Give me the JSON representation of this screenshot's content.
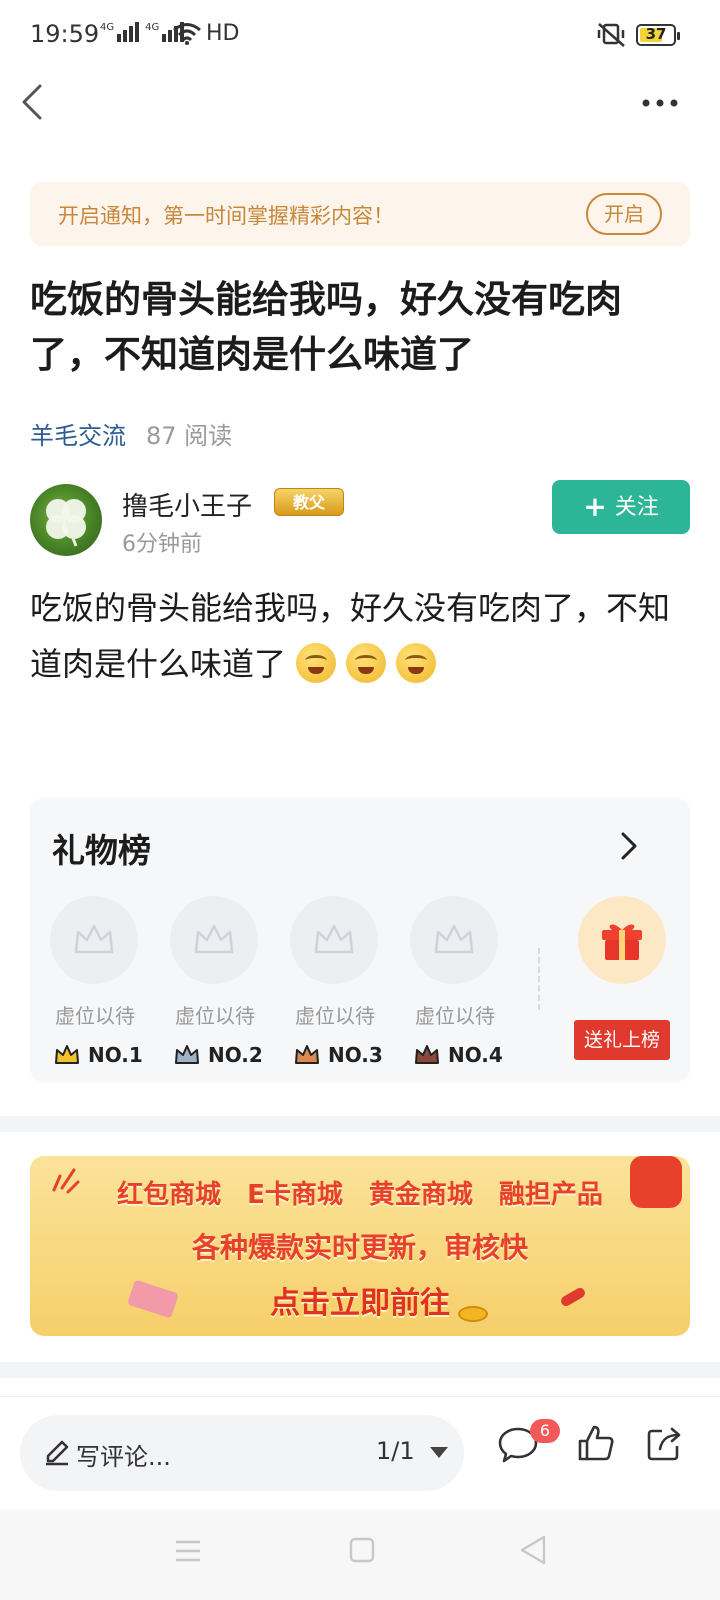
{
  "status_bar": {
    "time": "19:59",
    "network1": "4G",
    "network2": "4G",
    "hd_label": "HD",
    "battery": "37",
    "battery_color": "#f2d33a"
  },
  "nav": {
    "back_icon": "chevron-left-icon",
    "more_icon": "more-dots-icon"
  },
  "notify": {
    "text": "开启通知，第一时间掌握精彩内容！",
    "button_label": "开启",
    "color": "#c7883a"
  },
  "post": {
    "title": "吃饭的骨头能给我吗，好久没有吃肉了，不知道肉是什么味道了",
    "category": "羊毛交流",
    "read_count": "87 阅读",
    "body": "吃饭的骨头能给我吗，好久没有吃肉了，不知道肉是什么味道了",
    "emoji_count": 3
  },
  "author": {
    "name": "撸毛小王子",
    "badge": "教父",
    "time": "6分钟前",
    "follow_label": "关注",
    "follow_color": "#2cb596"
  },
  "gift_board": {
    "title": "礼物榜",
    "slots": [
      {
        "label": "虚位以待",
        "rank": "NO.1",
        "crown_color": "#f2c12e"
      },
      {
        "label": "虚位以待",
        "rank": "NO.2",
        "crown_color": "#9fb1c7"
      },
      {
        "label": "虚位以待",
        "rank": "NO.3",
        "crown_color": "#d98a4e"
      },
      {
        "label": "虚位以待",
        "rank": "NO.4",
        "crown_color": "#8a4a3a"
      }
    ],
    "send_label": "送礼上榜",
    "send_color": "#e03a2e"
  },
  "promo": {
    "items": [
      "红包商城",
      "E卡商城",
      "黄金商城",
      "融担产品"
    ],
    "subtitle": "各种爆款实时更新，审核快",
    "cta": "点击立即前往"
  },
  "bottom_bar": {
    "comment_placeholder": "写评论...",
    "page": "1/1",
    "comment_count": "6",
    "badge_color": "#f25a5a"
  }
}
